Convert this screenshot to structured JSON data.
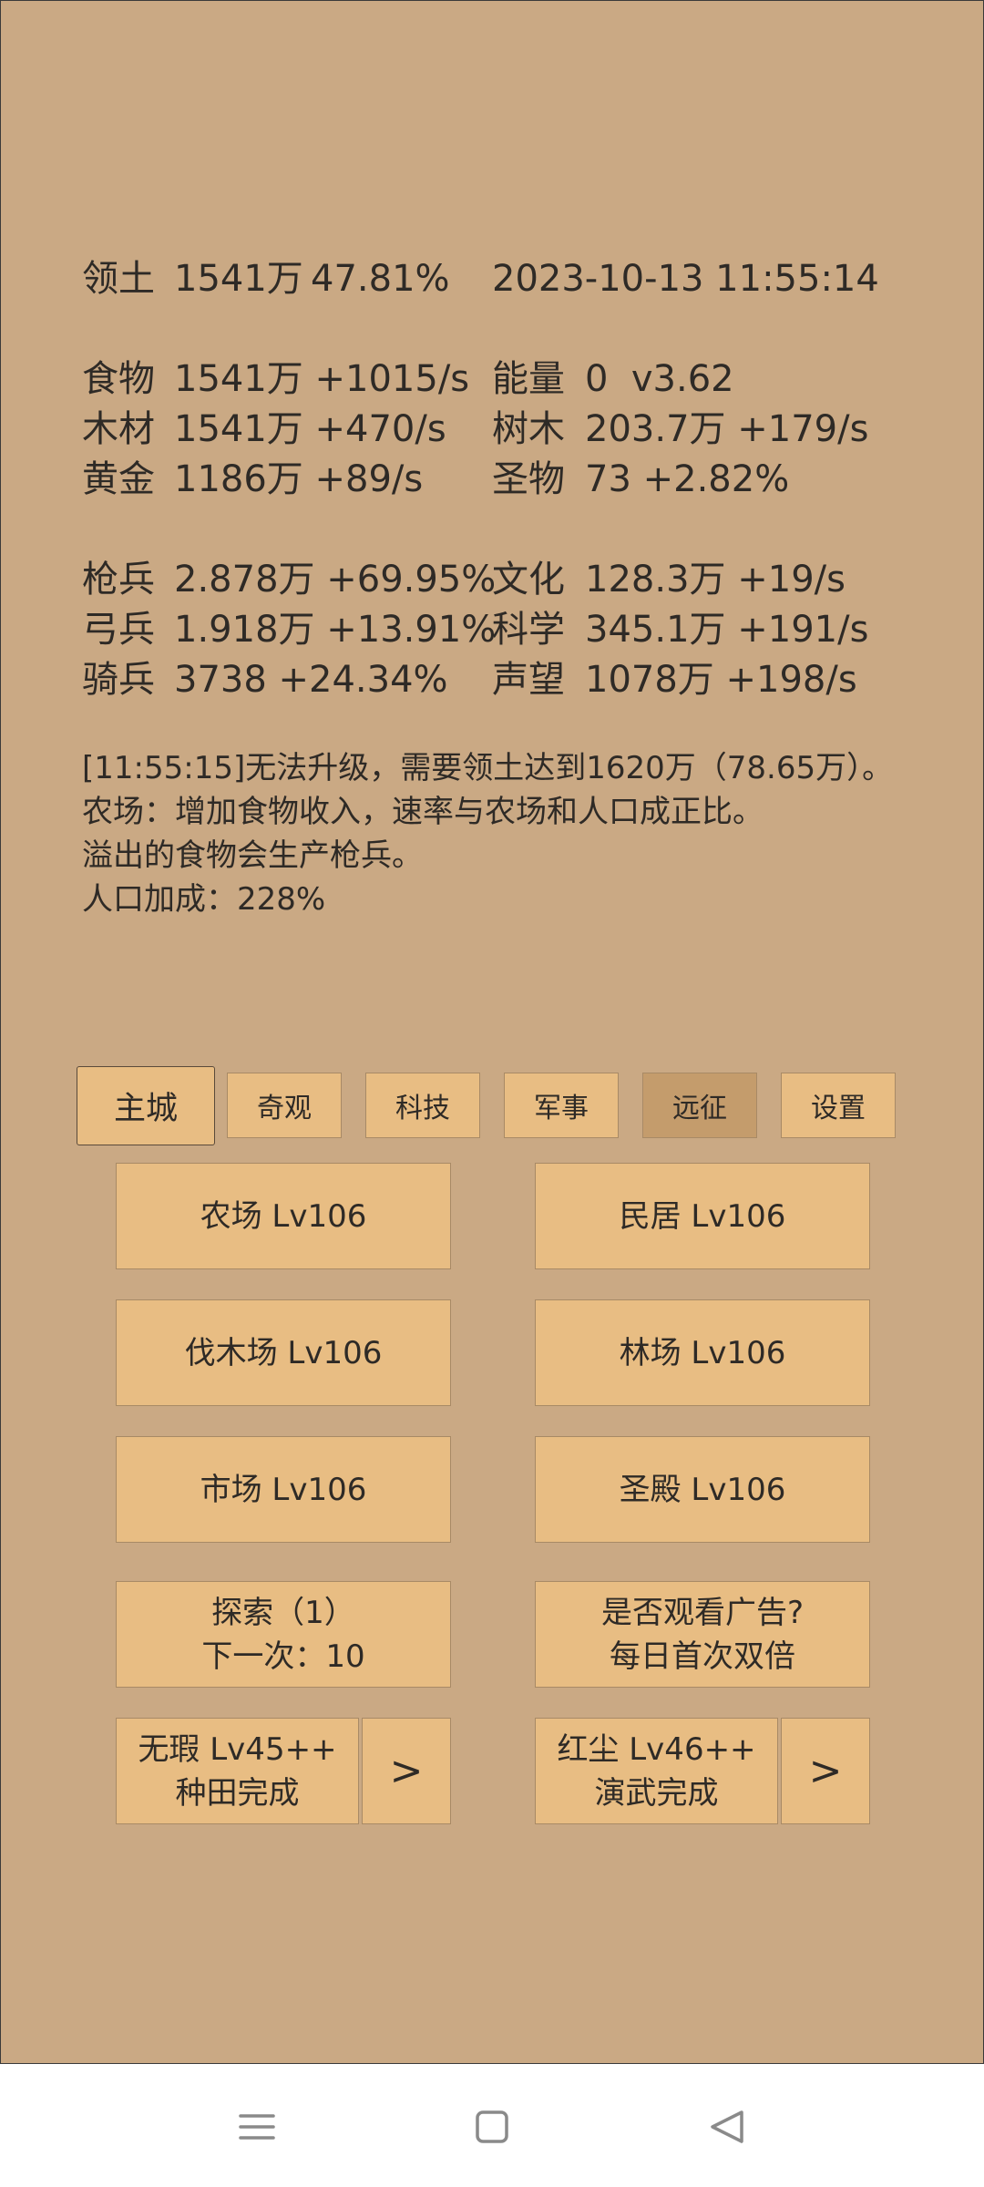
{
  "header": {
    "territory_label": "领土",
    "territory_value": "1541万",
    "territory_pct": "47.81%",
    "datetime": "2023-10-13 11:55:14"
  },
  "resources_left": [
    {
      "label": "食物",
      "value": "1541万 +1015/s"
    },
    {
      "label": "木材",
      "value": "1541万 +470/s"
    },
    {
      "label": "黄金",
      "value": "1186万 +89/s"
    }
  ],
  "resources_right": [
    {
      "label": "能量",
      "value": "0  v3.62"
    },
    {
      "label": "树木",
      "value": "203.7万 +179/s"
    },
    {
      "label": "圣物",
      "value": "73 +2.82%"
    }
  ],
  "military_left": [
    {
      "label": "枪兵",
      "value": "2.878万 +69.95%"
    },
    {
      "label": "弓兵",
      "value": "1.918万 +13.91%"
    },
    {
      "label": "骑兵",
      "value": "3738 +24.34%"
    }
  ],
  "military_right": [
    {
      "label": "文化",
      "value": "128.3万 +19/s"
    },
    {
      "label": "科学",
      "value": "345.1万 +191/s"
    },
    {
      "label": "声望",
      "value": "1078万 +198/s"
    }
  ],
  "messages": [
    "[11:55:15]无法升级，需要领土达到1620万（78.65万）。",
    "农场：增加食物收入，速率与农场和人口成正比。",
    "溢出的食物会生产枪兵。",
    "人口加成：228%"
  ],
  "tabs": [
    {
      "label": "主城"
    },
    {
      "label": "奇观"
    },
    {
      "label": "科技"
    },
    {
      "label": "军事"
    },
    {
      "label": "远征"
    },
    {
      "label": "设置"
    }
  ],
  "buildings": [
    {
      "label": "农场 Lv106"
    },
    {
      "label": "民居 Lv106"
    },
    {
      "label": "伐木场 Lv106"
    },
    {
      "label": "林场 Lv106"
    },
    {
      "label": "市场 Lv106"
    },
    {
      "label": "圣殿 Lv106"
    }
  ],
  "explore": {
    "line1": "探索（1）",
    "line2": "下一次：10"
  },
  "ad": {
    "line1": "是否观看广告?",
    "line2": "每日首次双倍"
  },
  "hero_left": {
    "line1": "无瑕 Lv45++",
    "line2": "种田完成",
    "arrow": ">"
  },
  "hero_right": {
    "line1": "红尘 Lv46++",
    "line2": "演武完成",
    "arrow": ">"
  },
  "colors": {
    "background": "#caa984",
    "button": "#e8bd83",
    "active_tab": "#c49c6c"
  },
  "navbar_icons": [
    "menu-icon",
    "home-square-icon",
    "back-triangle-icon"
  ]
}
